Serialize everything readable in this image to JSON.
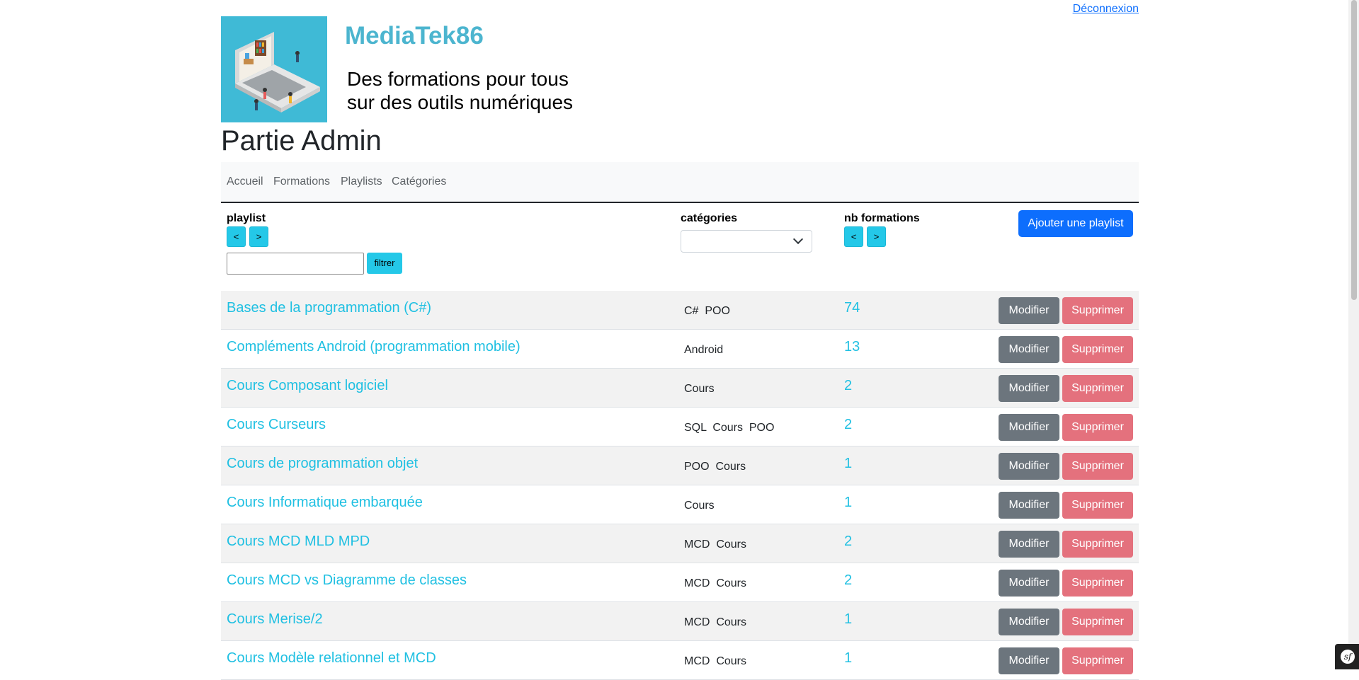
{
  "header": {
    "logout": "Déconnexion",
    "site_name": "MediaTek86",
    "tagline_line1": "Des formations pour tous",
    "tagline_line2": "sur des outils numériques",
    "admin_title": "Partie Admin"
  },
  "nav": {
    "items": [
      {
        "label": "Accueil"
      },
      {
        "label": "Formations"
      },
      {
        "label": "Playlists"
      },
      {
        "label": "Catégories"
      }
    ]
  },
  "filters": {
    "playlist_label": "playlist",
    "categories_label": "catégories",
    "nb_formations_label": "nb formations",
    "sort_asc": "<",
    "sort_desc": ">",
    "filter_placeholder": "",
    "filter_value": "",
    "filter_button": "filtrer",
    "category_selected": "",
    "add_button": "Ajouter une playlist"
  },
  "actions": {
    "edit": "Modifier",
    "delete": "Supprimer"
  },
  "rows": [
    {
      "name": "Bases de la programmation (C#)",
      "categories": "C#  POO",
      "count": "74"
    },
    {
      "name": "Compléments Android (programmation mobile)",
      "categories": "Android",
      "count": "13"
    },
    {
      "name": "Cours Composant logiciel",
      "categories": "Cours",
      "count": "2"
    },
    {
      "name": "Cours Curseurs",
      "categories": "SQL  Cours  POO",
      "count": "2"
    },
    {
      "name": "Cours de programmation objet",
      "categories": "POO  Cours",
      "count": "1"
    },
    {
      "name": "Cours Informatique embarquée",
      "categories": "Cours",
      "count": "1"
    },
    {
      "name": "Cours MCD MLD MPD",
      "categories": "MCD  Cours",
      "count": "2"
    },
    {
      "name": "Cours MCD vs Diagramme de classes",
      "categories": "MCD  Cours",
      "count": "2"
    },
    {
      "name": "Cours Merise/2",
      "categories": "MCD  Cours",
      "count": "1"
    },
    {
      "name": "Cours Modèle relationnel et MCD",
      "categories": "MCD  Cours",
      "count": "1"
    }
  ],
  "colors": {
    "accent": "#20c0e2",
    "primary": "#0d6efd",
    "secondary": "#6c757d",
    "danger": "#e4717d"
  }
}
